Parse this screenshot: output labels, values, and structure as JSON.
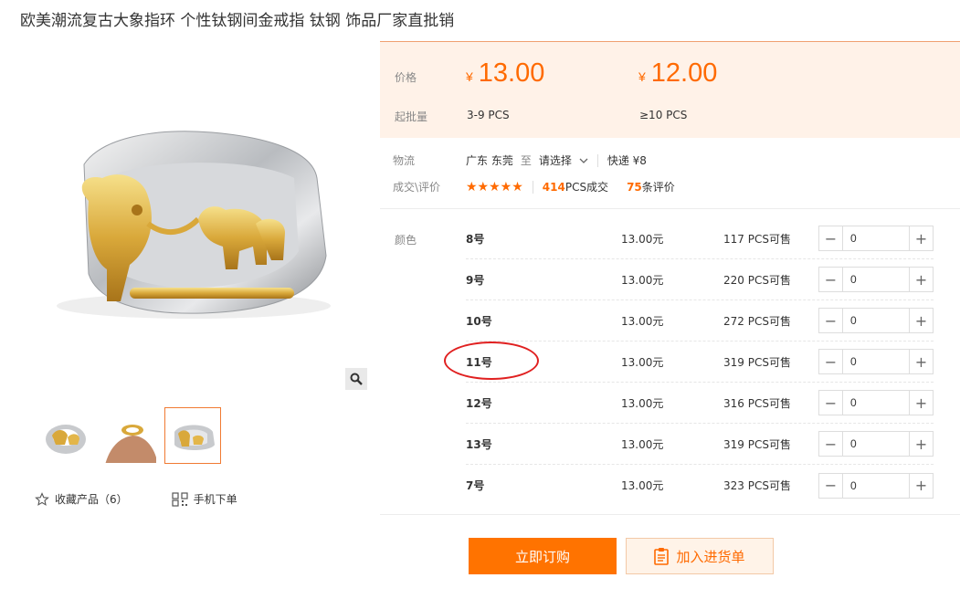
{
  "title": "欧美潮流复古大象指环 个性钛钢间金戒指 钛钢 饰品厂家直批销",
  "price": {
    "price_label": "价格",
    "moq_label": "起批量",
    "currency": "¥",
    "tiers": [
      {
        "price": "13.00",
        "qty": "3-9 PCS"
      },
      {
        "price": "12.00",
        "qty": "≥10 PCS"
      }
    ]
  },
  "logistics": {
    "label": "物流",
    "from": "广东 东莞",
    "to_word": "至",
    "select": "请选择",
    "express": "快递 ¥8"
  },
  "rating": {
    "label": "成交\\评价",
    "stars": "★★★★★",
    "deals_count": "414",
    "deals_text": "PCS成交",
    "reviews_count": "75",
    "reviews_text": "条评价"
  },
  "sku": {
    "label": "颜色",
    "rows": [
      {
        "name": "8号",
        "price": "13.00元",
        "stock": "117 PCS可售",
        "qty": "0"
      },
      {
        "name": "9号",
        "price": "13.00元",
        "stock": "220 PCS可售",
        "qty": "0"
      },
      {
        "name": "10号",
        "price": "13.00元",
        "stock": "272 PCS可售",
        "qty": "0"
      },
      {
        "name": "11号",
        "price": "13.00元",
        "stock": "319 PCS可售",
        "qty": "0"
      },
      {
        "name": "12号",
        "price": "13.00元",
        "stock": "316 PCS可售",
        "qty": "0"
      },
      {
        "name": "13号",
        "price": "13.00元",
        "stock": "319 PCS可售",
        "qty": "0"
      },
      {
        "name": "7号",
        "price": "13.00元",
        "stock": "323 PCS可售",
        "qty": "0"
      }
    ]
  },
  "actions": {
    "buy": "立即订购",
    "cart": "加入进货单",
    "favorite": "收藏产品（6）",
    "mobile": "手机下单"
  },
  "colors": {
    "accent": "#ff6a00",
    "buy_bg": "#ff7300",
    "price_bg": "#fff2e8",
    "annotation": "#e02020"
  },
  "icons": {
    "zoom": "magnifier-icon",
    "favorite": "star-outline-icon",
    "mobile": "qr-code-icon",
    "cart": "clipboard-icon",
    "dropdown": "chevron-down-icon"
  }
}
